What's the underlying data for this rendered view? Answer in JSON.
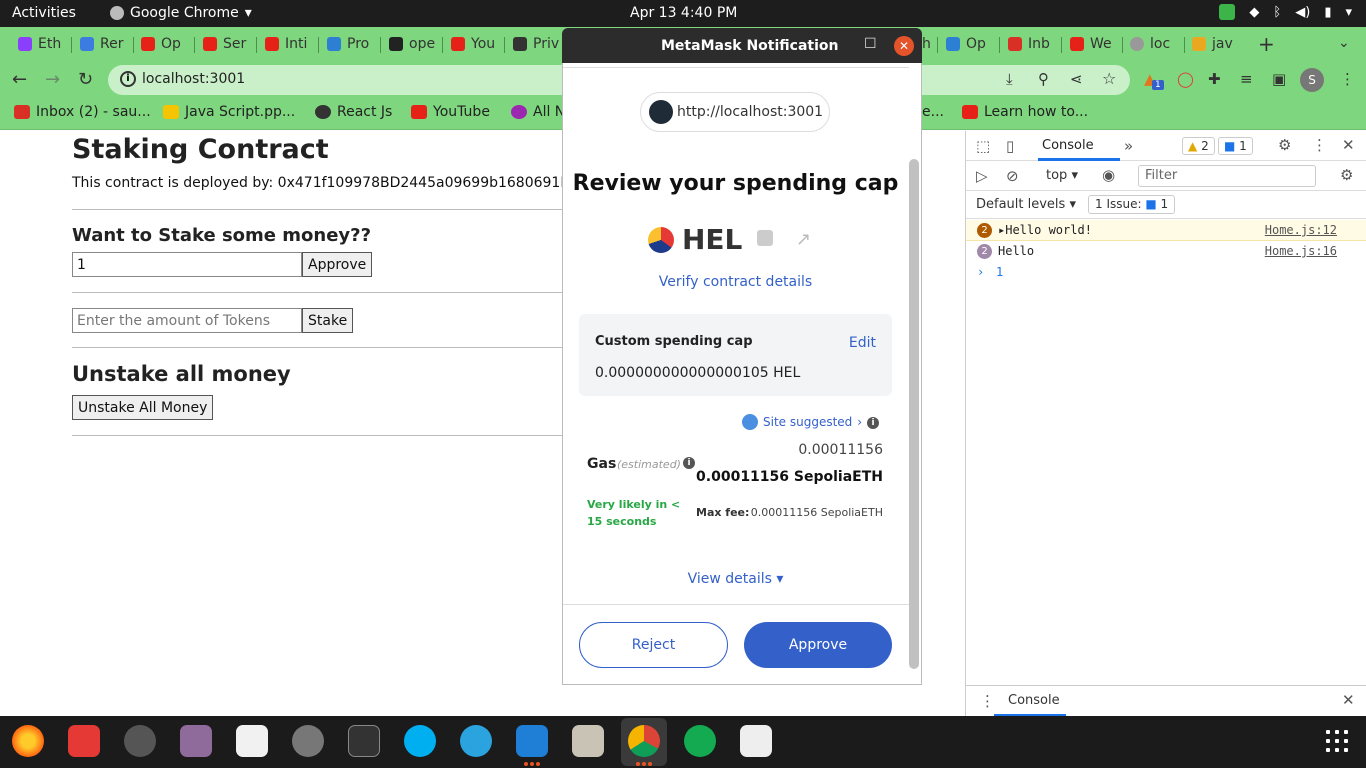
{
  "topbar": {
    "activities": "Activities",
    "app_name": "Google Chrome",
    "clock": "Apr 13  4:40 PM"
  },
  "tabs": [
    {
      "label": "Eth",
      "color": "#8a3ffc"
    },
    {
      "label": "Rer",
      "color": "#3c7be0"
    },
    {
      "label": "Op",
      "color": "#e62117"
    },
    {
      "label": "Ser",
      "color": "#e62117"
    },
    {
      "label": "Inti",
      "color": "#e62117"
    },
    {
      "label": "Pro",
      "color": "#2d7fd3"
    },
    {
      "label": "ope",
      "color": "#222222"
    },
    {
      "label": "You",
      "color": "#e62117"
    },
    {
      "label": "Priv",
      "color": "#333333"
    },
    {
      "label": "h",
      "color": "#7ed67e"
    },
    {
      "label": "Op",
      "color": "#2d7fd3"
    },
    {
      "label": "Inb",
      "color": "#d93025"
    },
    {
      "label": "We",
      "color": "#e62117"
    },
    {
      "label": "loc",
      "color": "#999999"
    },
    {
      "label": "jav",
      "color": "#e9a820"
    }
  ],
  "toolbar": {
    "url": "localhost:3001",
    "profile_initial": "S",
    "ext_badge": "1"
  },
  "bookmarks": [
    {
      "label": "Inbox (2) - sau...",
      "color": "#d93025"
    },
    {
      "label": "Java Script.pp...",
      "color": "#f6c500"
    },
    {
      "label": "React Js",
      "color": "#333333"
    },
    {
      "label": "YouTube",
      "color": "#e62117"
    },
    {
      "label": "All N",
      "color": "#9c27b0"
    },
    {
      "label": "e...",
      "color": "#7ed67e"
    },
    {
      "label": "Learn how to...",
      "color": "#e62117"
    }
  ],
  "page": {
    "title": "Staking Contract",
    "deployed_by": "This contract is deployed by: 0x471f109978BD2445a09699b1680691D2467",
    "stake_heading": "Want to Stake some money??",
    "approve_input_value": "1",
    "approve_button": "Approve",
    "stake_placeholder": "Enter the amount of Tokens",
    "stake_button": "Stake",
    "unstake_heading": "Unstake all money",
    "unstake_button": "Unstake All Money"
  },
  "devtools": {
    "tab_console": "Console",
    "warn_count": "2",
    "info_count": "1",
    "context": "top",
    "filter_placeholder": "Filter",
    "levels": "Default levels",
    "issues": "1 Issue:",
    "issues_count": "1",
    "logs": [
      {
        "count": "2",
        "message": "Hello world!",
        "source": "Home.js:12",
        "color": "#b05a00"
      },
      {
        "count": "2",
        "message": "Hello",
        "source": "Home.js:16",
        "color": "#a088a8"
      }
    ],
    "prompt_value": "1",
    "drawer_tab": "Console"
  },
  "metamask": {
    "window_title": "MetaMask Notification",
    "site_url": "http://localhost:3001",
    "title": "Review your spending cap",
    "token_symbol": "HEL",
    "verify_link": "Verify contract details",
    "cap_label": "Custom spending cap",
    "cap_edit": "Edit",
    "cap_value": "0.000000000000000105 HEL",
    "site_suggested": "Site suggested",
    "gas_label": "Gas",
    "gas_estimated": "(estimated)",
    "gas_fiat": "0.00011156",
    "gas_value": "0.00011156 SepoliaETH",
    "likely": "Very likely in < 15 seconds",
    "max_fee_label": "Max fee:",
    "max_fee_value": "0.00011156 SepoliaETH",
    "view_details": "View details",
    "reject": "Reject",
    "approve": "Approve"
  }
}
